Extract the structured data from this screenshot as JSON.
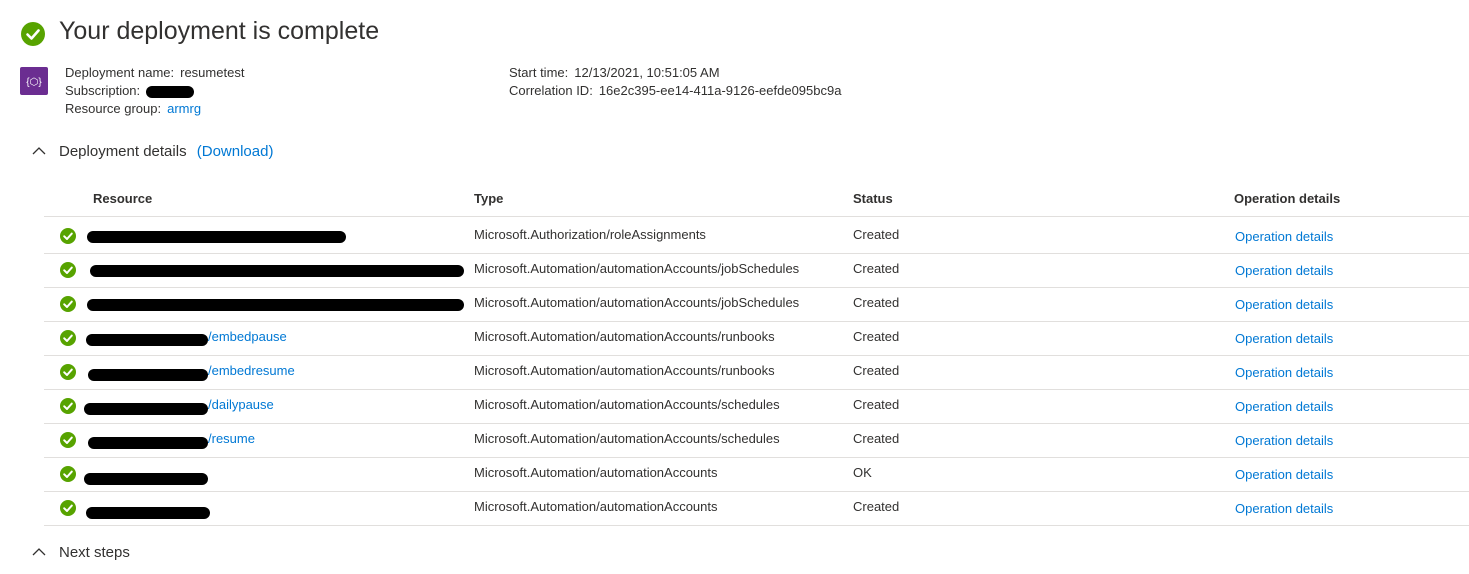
{
  "header": {
    "title": "Your deployment is complete",
    "deployment_name_label": "Deployment name:",
    "deployment_name": "resumetest",
    "subscription_label": "Subscription:",
    "resource_group_label": "Resource group:",
    "resource_group": "armrg",
    "start_time_label": "Start time:",
    "start_time": "12/13/2021, 10:51:05 AM",
    "correlation_id_label": "Correlation ID:",
    "correlation_id": "16e2c395-ee14-411a-9126-eefde095bc9a"
  },
  "details": {
    "heading": "Deployment details",
    "download": "(Download)"
  },
  "table": {
    "headers": [
      "Resource",
      "Type",
      "Status",
      "Operation details"
    ],
    "rows": [
      {
        "resource": "",
        "type": "Microsoft.Authorization/roleAssignments",
        "status": "Created",
        "op": "Operation details"
      },
      {
        "resource": "",
        "type": "Microsoft.Automation/automationAccounts/jobSchedules",
        "status": "Created",
        "op": "Operation details"
      },
      {
        "resource": "",
        "type": "Microsoft.Automation/automationAccounts/jobSchedules",
        "status": "Created",
        "op": "Operation details"
      },
      {
        "resource": "/embedpause",
        "type": "Microsoft.Automation/automationAccounts/runbooks",
        "status": "Created",
        "op": "Operation details"
      },
      {
        "resource": "/embedresume",
        "type": "Microsoft.Automation/automationAccounts/runbooks",
        "status": "Created",
        "op": "Operation details"
      },
      {
        "resource": "/dailypause",
        "type": "Microsoft.Automation/automationAccounts/schedules",
        "status": "Created",
        "op": "Operation details"
      },
      {
        "resource": "/resume",
        "type": "Microsoft.Automation/automationAccounts/schedules",
        "status": "Created",
        "op": "Operation details"
      },
      {
        "resource": "",
        "type": "Microsoft.Automation/automationAccounts",
        "status": "OK",
        "op": "Operation details"
      },
      {
        "resource": "",
        "type": "Microsoft.Automation/automationAccounts",
        "status": "Created",
        "op": "Operation details"
      }
    ]
  },
  "next_steps": {
    "heading": "Next steps"
  },
  "colors": {
    "success": "#57a300",
    "link": "#0078d4",
    "resource_group_icon": "#6b2d91"
  }
}
